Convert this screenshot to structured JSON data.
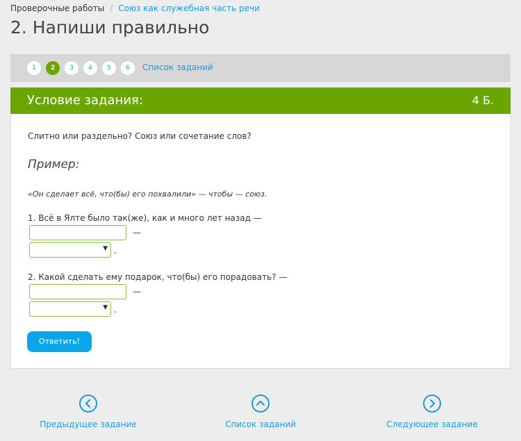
{
  "breadcrumb": {
    "root": "Проверочные работы",
    "separator": "/",
    "current": "Союз как служебная часть речи"
  },
  "page_title": "2. Напиши правильно",
  "pager": {
    "numbers": [
      "1",
      "2",
      "3",
      "4",
      "5",
      "6"
    ],
    "active_index": 1,
    "list_link": "Список заданий"
  },
  "task": {
    "header_label": "Условие задания:",
    "points": "4 Б.",
    "question": "Слитно или раздельно? Союз или сочетание слов?",
    "example_title": "Пример:",
    "example_text": "«Он сделает всё, что(бы) его похвалили» — чтобы — союз.",
    "items": [
      {
        "text": "1. Всё в Ялте было так(же), как и много лет назад —",
        "dash": "—",
        "dot": "."
      },
      {
        "text": "2. Какой сделать ему подарок, что(бы) его порадовать? —",
        "dash": "—",
        "dot": "."
      }
    ],
    "submit_label": "Ответить!"
  },
  "footer_nav": {
    "prev_label": "Предыдущее задание",
    "list_label": "Список заданий",
    "next_label": "Следующее задание"
  },
  "colors": {
    "accent_green": "#6aa500",
    "link_blue": "#1a9cd6",
    "button_blue": "#0ba6e8"
  }
}
